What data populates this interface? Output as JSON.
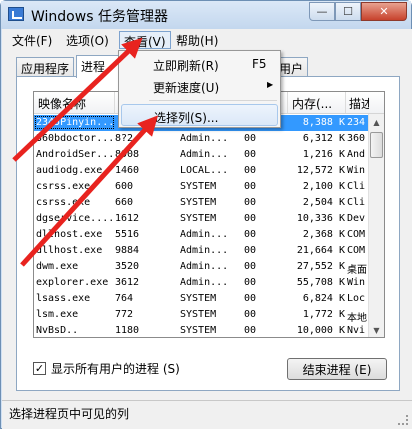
{
  "window": {
    "title": "Windows 任务管理器",
    "min_label": "—",
    "max_label": "☐",
    "close_label": "✕"
  },
  "menu": [
    "文件(F)",
    "选项(O)",
    "查看(V)",
    "帮助(H)"
  ],
  "tabs": [
    "应用程序",
    "进程",
    "用户"
  ],
  "dropdown": {
    "items": [
      {
        "label": "立即刷新(R)",
        "shortcut": "F5"
      },
      {
        "label": "更新速度(U)",
        "submenu_arrow": "▶"
      },
      {
        "label": "选择列(S)..."
      }
    ]
  },
  "process_table": {
    "columns": [
      "映像名称",
      "",
      "",
      "",
      "内存(...",
      "描述"
    ],
    "rows": [
      [
        "2345Pinyin...",
        "",
        "",
        "",
        "8,388 K",
        "234"
      ],
      [
        "360bdoctor...",
        "8?2",
        "Admin...",
        "00",
        "6,312 K",
        "360"
      ],
      [
        "AndroidSer...",
        "8908",
        "Admin...",
        "00",
        "1,216 K",
        "And"
      ],
      [
        "audiodg.exe",
        "1460",
        "LOCAL...",
        "00",
        "12,572 K",
        "Win"
      ],
      [
        "csrss.exe",
        "600",
        "SYSTEM",
        "00",
        "2,100 K",
        "Cli"
      ],
      [
        "csrss.exe",
        "660",
        "SYSTEM",
        "00",
        "2,504 K",
        "Cli"
      ],
      [
        "dgservice....",
        "1612",
        "SYSTEM",
        "00",
        "10,336 K",
        "Dev"
      ],
      [
        "dllhost.exe",
        "5516",
        "Admin...",
        "00",
        "2,368 K",
        "COM"
      ],
      [
        "dllhost.exe",
        "9884",
        "Admin...",
        "00",
        "21,664 K",
        "COM"
      ],
      [
        "dwm.exe",
        "3520",
        "Admin...",
        "00",
        "27,552 K",
        "桌面"
      ],
      [
        "explorer.exe",
        "3612",
        "Admin...",
        "00",
        "55,708 K",
        "Win"
      ],
      [
        "lsass.exe",
        "764",
        "SYSTEM",
        "00",
        "6,824 K",
        "Loc"
      ],
      [
        "lsm.exe",
        "772",
        "SYSTEM",
        "00",
        "1,772 K",
        "本地"
      ],
      [
        "NvBsD..",
        "1180",
        "SYSTEM",
        "00",
        "10,000 K",
        "Nvi"
      ]
    ]
  },
  "show_all_users": {
    "label": "显示所有用户的进程 (S)",
    "checked": "✓"
  },
  "end_process_label": "结束进程 (E)",
  "status_text": "选择进程页中可见的列",
  "scroll": {
    "up": "▲",
    "down": "▼"
  },
  "colors": {
    "selection": "#3399ff",
    "annotation_arrow": "#e8231f"
  }
}
